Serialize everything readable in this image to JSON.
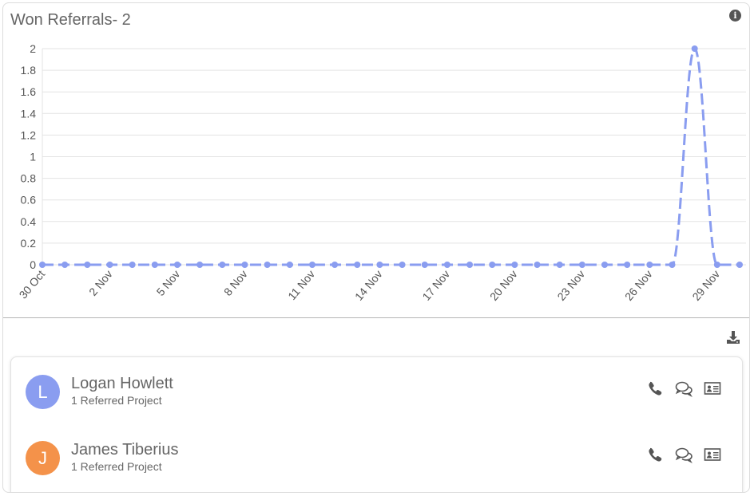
{
  "card": {
    "title": "Won Referrals- 2",
    "info_icon": "info-circle-icon"
  },
  "chart_data": {
    "type": "line",
    "x": [
      "30 Oct",
      "31 Oct",
      "1 Nov",
      "2 Nov",
      "3 Nov",
      "4 Nov",
      "5 Nov",
      "6 Nov",
      "7 Nov",
      "8 Nov",
      "9 Nov",
      "10 Nov",
      "11 Nov",
      "12 Nov",
      "13 Nov",
      "14 Nov",
      "15 Nov",
      "16 Nov",
      "17 Nov",
      "18 Nov",
      "19 Nov",
      "20 Nov",
      "21 Nov",
      "22 Nov",
      "23 Nov",
      "24 Nov",
      "25 Nov",
      "26 Nov",
      "27 Nov",
      "28 Nov",
      "29 Nov",
      "30 Nov"
    ],
    "x_tick_labels": [
      "30 Oct",
      "2 Nov",
      "5 Nov",
      "8 Nov",
      "11 Nov",
      "14 Nov",
      "17 Nov",
      "20 Nov",
      "23 Nov",
      "26 Nov",
      "29 Nov"
    ],
    "series": [
      {
        "values": [
          0,
          0,
          0,
          0,
          0,
          0,
          0,
          0,
          0,
          0,
          0,
          0,
          0,
          0,
          0,
          0,
          0,
          0,
          0,
          0,
          0,
          0,
          0,
          0,
          0,
          0,
          0,
          0,
          0,
          2,
          0,
          0
        ]
      }
    ],
    "y_ticks": [
      0,
      0.2,
      0.4,
      0.6,
      0.8,
      1,
      1.2,
      1.4,
      1.6,
      1.8,
      2
    ],
    "ylim": [
      0,
      2
    ],
    "grid": true,
    "color": "#8a9df0"
  },
  "toolbar": {
    "download_icon": "download-icon"
  },
  "referrers": [
    {
      "initial": "L",
      "name": "Logan Howlett",
      "subtitle": "1 Referred Project",
      "avatar_color": "#8a9df0",
      "icons": [
        "phone-icon",
        "chat-icon",
        "contact-card-icon"
      ]
    },
    {
      "initial": "J",
      "name": "James Tiberius",
      "subtitle": "1 Referred Project",
      "avatar_color": "#f4924a",
      "icons": [
        "phone-icon",
        "chat-icon",
        "contact-card-icon"
      ]
    }
  ]
}
